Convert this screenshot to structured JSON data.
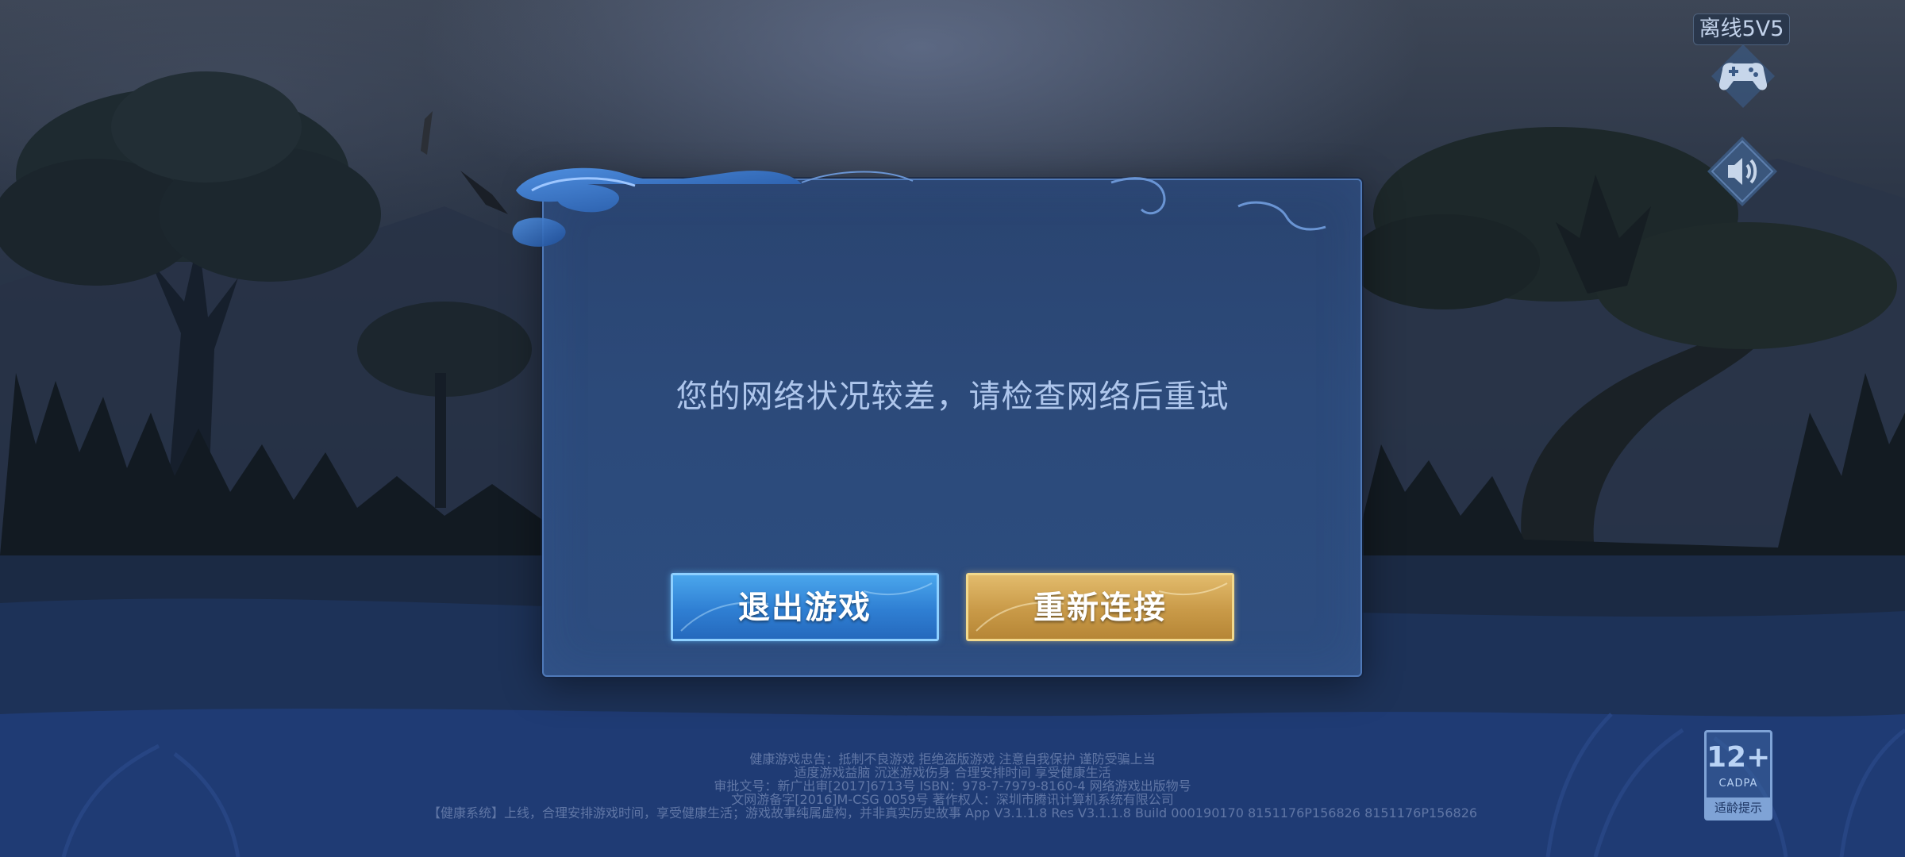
{
  "mode_label": "离线5V5",
  "dialog": {
    "message": "您的网络状况较差，请检查网络后重试",
    "exit_button_label": "退出游戏",
    "reconnect_button_label": "重新连接"
  },
  "footer_lines": [
    "健康游戏忠告：抵制不良游戏 拒绝盗版游戏 注意自我保护 谨防受骗上当",
    "适度游戏益脑 沉迷游戏伤身 合理安排时间 享受健康生活",
    "审批文号：新广出审[2017]6713号 ISBN：978-7-7979-8160-4 网络游戏出版物号",
    "文网游备字[2016]M-CSG 0059号 著作权人：深圳市腾讯计算机系统有限公司",
    "【健康系统】上线，合理安排游戏时间，享受健康生活；游戏故事纯属虚构，并非真实历史故事 App V3.1.1.8 Res V3.1.1.8 Build 000190170 8151176P156826 8151176P156826"
  ],
  "age_rating": {
    "number": "12+",
    "org": "CADPA",
    "tip": "适龄提示"
  },
  "icons": {
    "top_right_1": "gamepad-icon",
    "top_right_2": "speaker-icon"
  },
  "colors": {
    "dialog_bg": "#2c4a7a",
    "dialog_border": "#4f79b8",
    "message_text": "#aec6ec",
    "exit_button": "#2f7fd3",
    "reconnect_button": "#c99a48"
  }
}
